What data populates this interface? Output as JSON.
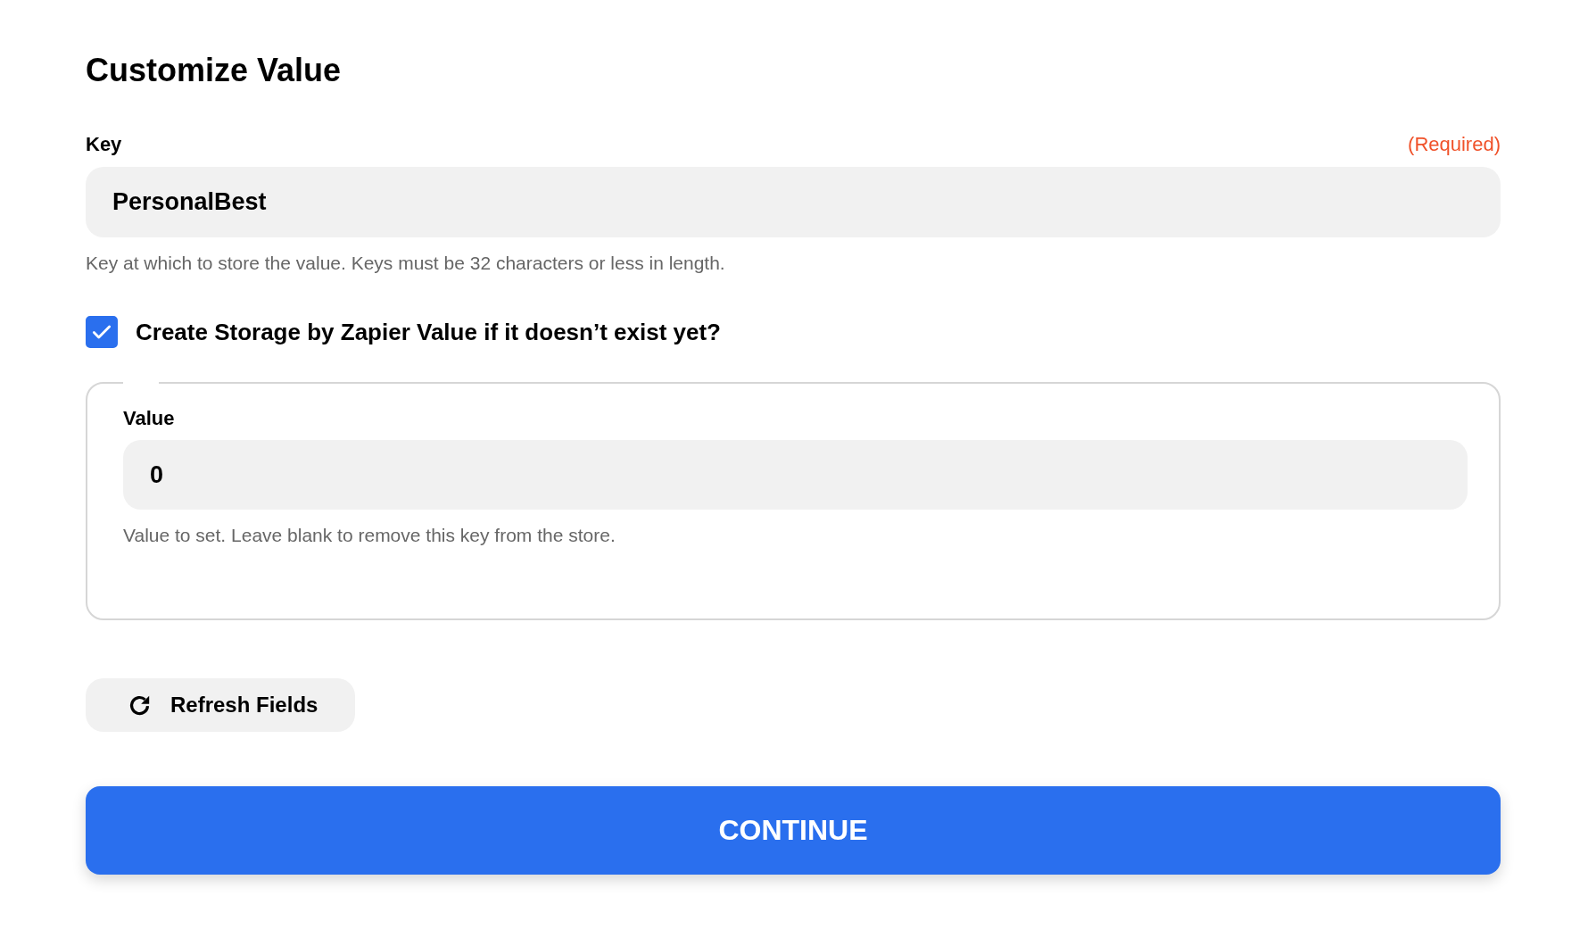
{
  "title": "Customize Value",
  "key_field": {
    "label": "Key",
    "required_note": "(Required)",
    "value": "PersonalBest",
    "help": "Key at which to store the value. Keys must be 32 characters or less in length."
  },
  "create_option": {
    "label": "Create Storage by Zapier Value if it doesn’t exist yet?",
    "checked": true
  },
  "value_field": {
    "label": "Value",
    "value": "0",
    "help": "Value to set. Leave blank to remove this key from the store."
  },
  "refresh_button": {
    "label": "Refresh Fields"
  },
  "continue_button": {
    "label": "CONTINUE"
  }
}
